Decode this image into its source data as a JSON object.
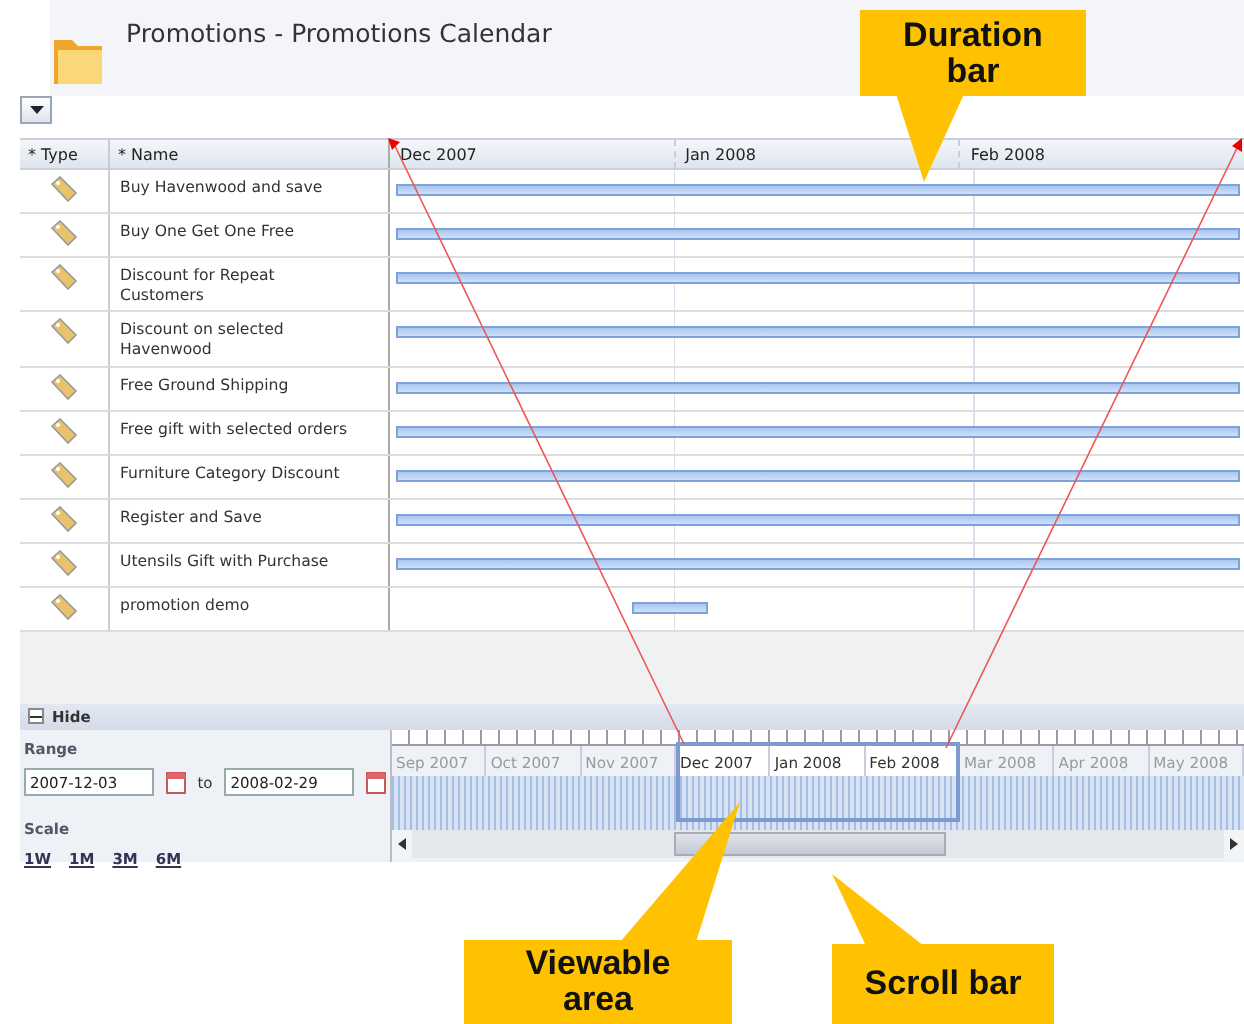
{
  "title": "Promotions - Promotions Calendar",
  "columns": [
    "* Type",
    "* Name"
  ],
  "timeline_months": [
    "Dec 2007",
    "Jan 2008",
    "Feb 2008"
  ],
  "rows": [
    {
      "name": "Buy Havenwood and save",
      "kind": "full"
    },
    {
      "name": "Buy One Get One Free",
      "kind": "full"
    },
    {
      "name": "Discount for Repeat\nCustomers",
      "kind": "full"
    },
    {
      "name": "Discount on selected\nHavenwood",
      "kind": "full"
    },
    {
      "name": "Free Ground Shipping",
      "kind": "full"
    },
    {
      "name": "Free gift with selected orders",
      "kind": "full"
    },
    {
      "name": "Furniture Category Discount",
      "kind": "full"
    },
    {
      "name": "Register and Save",
      "kind": "full"
    },
    {
      "name": "Utensils Gift with Purchase",
      "kind": "full"
    },
    {
      "name": "promotion demo",
      "kind": "short"
    }
  ],
  "panel_toggle": {
    "label": "Hide",
    "expanded": true
  },
  "range": {
    "label": "Range",
    "from": "2007-12-03",
    "separator": "to",
    "to": "2008-02-29"
  },
  "scale": {
    "label": "Scale",
    "options": [
      "1W",
      "1M",
      "3M",
      "6M"
    ]
  },
  "overview_months": [
    {
      "label": "Sep 2007",
      "selected": false
    },
    {
      "label": "Oct 2007",
      "selected": false
    },
    {
      "label": "Nov 2007",
      "selected": false
    },
    {
      "label": "Dec 2007",
      "selected": true
    },
    {
      "label": "Jan 2008",
      "selected": true
    },
    {
      "label": "Feb 2008",
      "selected": true
    },
    {
      "label": "Mar 2008",
      "selected": false
    },
    {
      "label": "Apr 2008",
      "selected": false
    },
    {
      "label": "May 2008",
      "selected": false
    }
  ],
  "callouts": [
    {
      "text": "Duration bar"
    },
    {
      "text": "Viewable area"
    },
    {
      "text": "Scroll bar"
    }
  ]
}
